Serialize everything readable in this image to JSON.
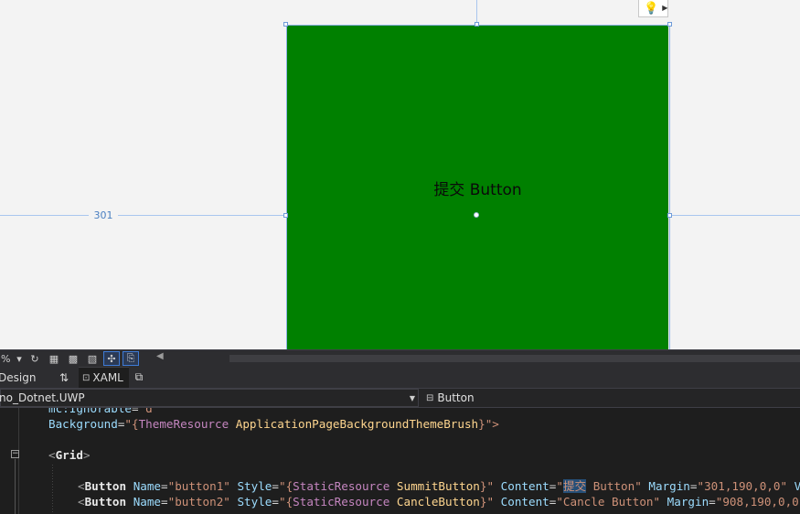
{
  "designer": {
    "margin_left_label": "301",
    "button_content": "提交 Button",
    "button_background": "#008000",
    "lightbulb_icon": "lightbulb-icon"
  },
  "toolbar": {
    "zoom_text": "%",
    "tools": [
      {
        "name": "refresh-icon",
        "glyph": "↻"
      },
      {
        "name": "grid-icon",
        "glyph": "▦"
      },
      {
        "name": "snap-to-grid-icon",
        "glyph": "▩"
      },
      {
        "name": "artboard-icon",
        "glyph": "▧"
      },
      {
        "name": "snap-to-lines-icon",
        "glyph": "✣"
      },
      {
        "name": "project-code-icon",
        "glyph": "⎘"
      }
    ]
  },
  "tabs": {
    "design_label": "Design",
    "swap_glyph": "⇅",
    "xaml_label": "XAML"
  },
  "navbar": {
    "left_value": "no_Dotnet.UWP",
    "right_value": "Button"
  },
  "code": {
    "line1": {
      "attr": "mc:Ignorable",
      "eq": "=",
      "val": "\"d\""
    },
    "line2": {
      "attr": "Background",
      "eq": "=",
      "open": "\"{",
      "kw": "ThemeResource",
      "res": "ApplicationPageBackgroundThemeBrush",
      "close": "}\">"
    },
    "line4": {
      "lt": "<",
      "el": "Grid",
      "gt": ">"
    },
    "line6": {
      "lt": "<",
      "el": "Button",
      "a1": "Name",
      "v1": "\"button1\"",
      "a2": "Style",
      "v2o": "\"{",
      "v2k": "StaticResource",
      "v2r": "SummitButton",
      "v2c": "}\"",
      "a3": "Content",
      "v3q": "\"",
      "v3h": "提交",
      "v3r": " Button\"",
      "a4": "Margin",
      "v4": "\"301,190,0,0\"",
      "tail": " V"
    },
    "line7": {
      "lt": "<",
      "el": "Button",
      "a1": "Name",
      "v1": "\"button2\"",
      "a2": "Style",
      "v2o": "\"{",
      "v2k": "StaticResource",
      "v2r": "CancleButton",
      "v2c": "}\"",
      "a3": "Content",
      "v3": "\"Cancle Button\"",
      "a4": "Margin",
      "v4": "\"908,190,0,0"
    }
  }
}
